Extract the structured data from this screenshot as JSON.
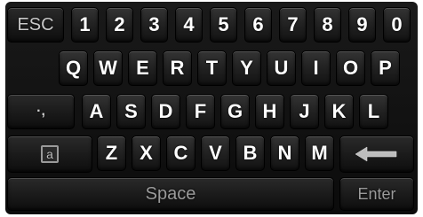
{
  "keyboard": {
    "row1": {
      "esc": "ESC",
      "keys": [
        "1",
        "2",
        "3",
        "4",
        "5",
        "6",
        "7",
        "8",
        "9",
        "0"
      ]
    },
    "row2": {
      "keys": [
        "Q",
        "W",
        "E",
        "R",
        "T",
        "Y",
        "U",
        "I",
        "O",
        "P"
      ]
    },
    "row3": {
      "symbol": "·,",
      "keys": [
        "A",
        "S",
        "D",
        "F",
        "G",
        "H",
        "J",
        "K",
        "L"
      ]
    },
    "row4": {
      "case_label": "a",
      "keys": [
        "Z",
        "X",
        "C",
        "V",
        "B",
        "N",
        "M"
      ],
      "backspace_icon": "left-arrow-icon"
    },
    "row5": {
      "space": "Space",
      "enter": "Enter"
    }
  }
}
